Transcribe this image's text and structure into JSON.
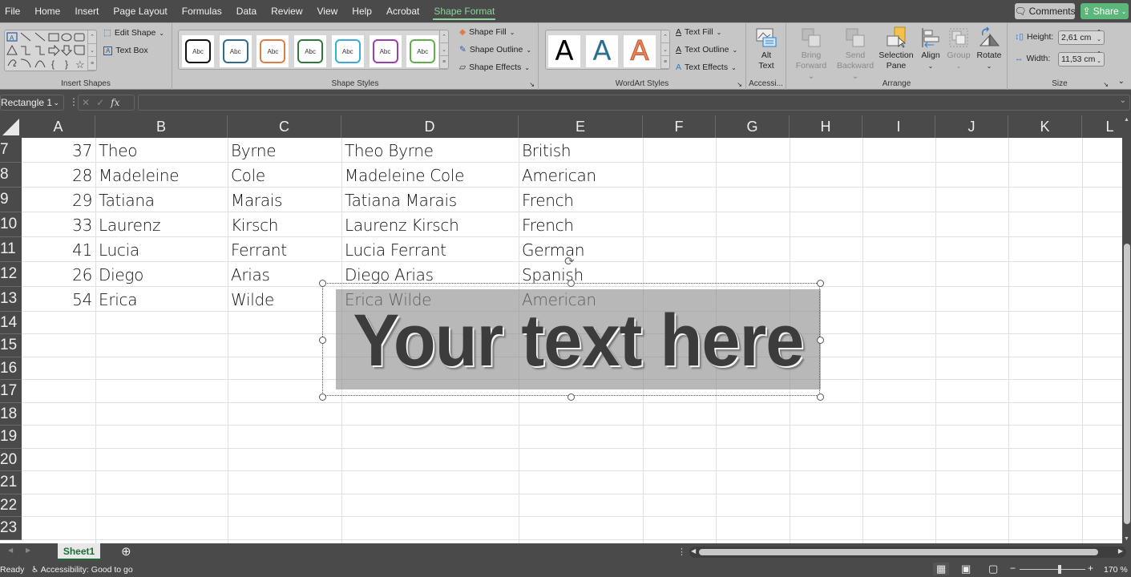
{
  "menu": {
    "tabs": [
      "File",
      "Home",
      "Insert",
      "Page Layout",
      "Formulas",
      "Data",
      "Review",
      "View",
      "Help",
      "Acrobat",
      "Shape Format"
    ],
    "active_tab": "Shape Format",
    "comments_label": "Comments",
    "share_label": "Share"
  },
  "ribbon": {
    "insert_shapes": {
      "label": "Insert Shapes",
      "edit_shape": "Edit Shape",
      "text_box": "Text Box"
    },
    "shape_styles": {
      "label": "Shape Styles",
      "preset_text": "Abc",
      "preset_colors": [
        "#111111",
        "#2e6b8f",
        "#e07b45",
        "#2f7a3b",
        "#3aaadf",
        "#9b3fae",
        "#5fb04a"
      ],
      "shape_fill": "Shape Fill",
      "shape_outline": "Shape Outline",
      "shape_effects": "Shape Effects"
    },
    "wordart_styles": {
      "label": "WordArt Styles",
      "preset_letter": "A",
      "preset_colors": [
        "#000000",
        "#2a6f8f",
        "#e8835a"
      ],
      "text_fill": "Text Fill",
      "text_outline": "Text Outline",
      "text_effects": "Text Effects"
    },
    "accessibility": {
      "label": "Accessi...",
      "alt_text_1": "Alt",
      "alt_text_2": "Text"
    },
    "arrange": {
      "label": "Arrange",
      "bring_forward_1": "Bring",
      "bring_forward_2": "Forward",
      "send_backward_1": "Send",
      "send_backward_2": "Backward",
      "selection_pane_1": "Selection",
      "selection_pane_2": "Pane",
      "align": "Align",
      "group": "Group",
      "rotate": "Rotate"
    },
    "size": {
      "label": "Size",
      "height_label": "Height:",
      "height_value": "2,61 cm",
      "width_label": "Width:",
      "width_value": "11,53 cm"
    }
  },
  "formula_bar": {
    "name_box": "Rectangle 1",
    "fx": "fx",
    "formula": ""
  },
  "grid": {
    "columns": [
      "A",
      "B",
      "C",
      "D",
      "E",
      "F",
      "G",
      "H",
      "I",
      "J",
      "K",
      "L"
    ],
    "rows": [
      {
        "num": "7",
        "cells": [
          "37",
          "Theo",
          "Byrne",
          "Theo Byrne",
          "British"
        ]
      },
      {
        "num": "8",
        "cells": [
          "28",
          "Madeleine",
          "Cole",
          "Madeleine Cole",
          "American"
        ]
      },
      {
        "num": "9",
        "cells": [
          "29",
          "Tatiana",
          "Marais",
          "Tatiana Marais",
          "French"
        ]
      },
      {
        "num": "10",
        "cells": [
          "33",
          "Laurenz",
          "Kirsch",
          "Laurenz Kirsch",
          "French"
        ]
      },
      {
        "num": "11",
        "cells": [
          "41",
          "Lucia",
          "Ferrant",
          "Lucia Ferrant",
          "German"
        ]
      },
      {
        "num": "12",
        "cells": [
          "26",
          "Diego",
          "Arias",
          "Diego Arias",
          "Spanish"
        ]
      },
      {
        "num": "13",
        "cells": [
          "54",
          "Erica",
          "Wilde",
          "Erica Wilde",
          "American"
        ]
      },
      {
        "num": "14",
        "cells": []
      },
      {
        "num": "15",
        "cells": []
      },
      {
        "num": "16",
        "cells": []
      },
      {
        "num": "17",
        "cells": []
      },
      {
        "num": "18",
        "cells": []
      },
      {
        "num": "19",
        "cells": []
      },
      {
        "num": "20",
        "cells": []
      },
      {
        "num": "21",
        "cells": []
      },
      {
        "num": "22",
        "cells": []
      },
      {
        "num": "23",
        "cells": []
      }
    ]
  },
  "shape": {
    "name": "Rectangle 1",
    "text": "Your text here"
  },
  "sheets": {
    "tabs": [
      "Sheet1"
    ],
    "active": "Sheet1"
  },
  "status": {
    "ready": "Ready",
    "accessibility": "Accessibility: Good to go",
    "zoom": "170 %",
    "zoom_percent": 170
  }
}
